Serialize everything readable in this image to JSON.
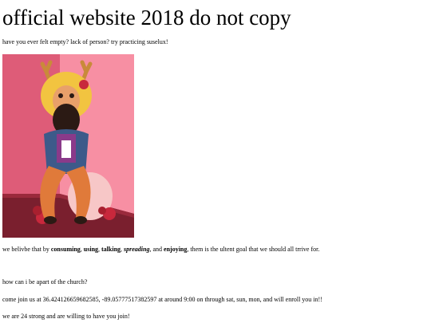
{
  "page": {
    "title": "official website 2018 do not copy",
    "intro": "have you ever felt empty? lack of person? try practicing suselux!",
    "belief": {
      "before": "we belivbe that by ",
      "w1": "consuming",
      "sep1": ", ",
      "w2": "using",
      "sep2": ", ",
      "w3": "talking",
      "sep3": ", ",
      "w4": "spreading",
      "sep4": ", and ",
      "w5": "enjoying",
      "after": ", them is the ultent goal that we should all trrive for."
    },
    "question": "how can i be apart of the church?",
    "join": "come join us at 36.424126659682585, -89.05777517382597 at around 9:00 on through sat, sun, mon, and will enroll you in!!",
    "strong": "we are 24 strong and are willing to have you join!"
  },
  "colors": {
    "wall_left": "#de5c78",
    "wall_right": "#f78fa3",
    "floor": "#7a1f2e",
    "hair": "#f2c440",
    "skin": "#e8a06a",
    "beard": "#2b1a14",
    "jacket": "#3d5a8a",
    "shirt": "#8a3a8a",
    "leg": "#e07a3a",
    "balloon": "#f7c7c7",
    "rose": "#c8283c"
  },
  "illustration": {
    "subject": "cartoon character with blonde hair, antlers and a dark beard sitting on a pink floor"
  }
}
